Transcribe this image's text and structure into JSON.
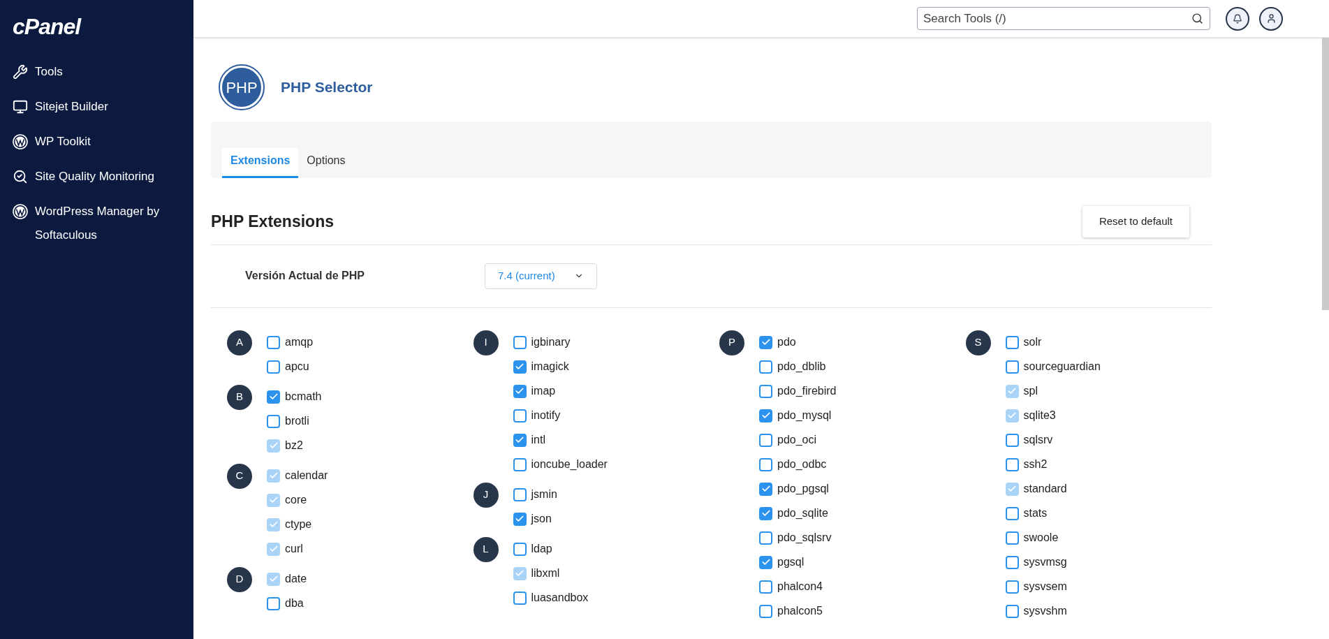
{
  "sidebar": {
    "logo": "cPanel",
    "items": [
      {
        "label": "Tools",
        "kind": "tools"
      },
      {
        "label": "Sitejet Builder",
        "kind": "builder"
      },
      {
        "label": "WP Toolkit",
        "kind": "wordpress"
      },
      {
        "label": "Site Quality Monitoring",
        "kind": "monitoring"
      },
      {
        "label": "WordPress Manager by Softaculous",
        "kind": "wordpress"
      }
    ]
  },
  "topbar": {
    "search": {
      "placeholder": "Search Tools (/)"
    }
  },
  "page": {
    "title": "PHP Selector",
    "icon_text": "PHP"
  },
  "tabs": [
    {
      "label": "Extensions",
      "selected": true
    },
    {
      "label": "Options",
      "selected": false
    }
  ],
  "section": {
    "title": "PHP Extensions",
    "reset_button": "Reset to default",
    "version_label": "Versión Actual de PHP",
    "version_value": "7.4 (current)"
  },
  "columns": [
    {
      "groups": [
        {
          "letter": "A",
          "items": [
            {
              "name": "amqp",
              "checked": false,
              "disabled": false
            },
            {
              "name": "apcu",
              "checked": false,
              "disabled": false
            }
          ]
        },
        {
          "letter": "B",
          "items": [
            {
              "name": "bcmath",
              "checked": true,
              "disabled": false
            },
            {
              "name": "brotli",
              "checked": false,
              "disabled": false
            },
            {
              "name": "bz2",
              "checked": true,
              "disabled": true
            }
          ]
        },
        {
          "letter": "C",
          "items": [
            {
              "name": "calendar",
              "checked": true,
              "disabled": true
            },
            {
              "name": "core",
              "checked": true,
              "disabled": true
            },
            {
              "name": "ctype",
              "checked": true,
              "disabled": true
            },
            {
              "name": "curl",
              "checked": true,
              "disabled": true
            }
          ]
        },
        {
          "letter": "D",
          "items": [
            {
              "name": "date",
              "checked": true,
              "disabled": true
            },
            {
              "name": "dba",
              "checked": false,
              "disabled": false
            }
          ]
        }
      ]
    },
    {
      "groups": [
        {
          "letter": "I",
          "items": [
            {
              "name": "igbinary",
              "checked": false,
              "disabled": false
            },
            {
              "name": "imagick",
              "checked": true,
              "disabled": false
            },
            {
              "name": "imap",
              "checked": true,
              "disabled": false
            },
            {
              "name": "inotify",
              "checked": false,
              "disabled": false
            },
            {
              "name": "intl",
              "checked": true,
              "disabled": false
            },
            {
              "name": "ioncube_loader",
              "checked": false,
              "disabled": false
            }
          ]
        },
        {
          "letter": "J",
          "items": [
            {
              "name": "jsmin",
              "checked": false,
              "disabled": false
            },
            {
              "name": "json",
              "checked": true,
              "disabled": false
            }
          ]
        },
        {
          "letter": "L",
          "items": [
            {
              "name": "ldap",
              "checked": false,
              "disabled": false
            },
            {
              "name": "libxml",
              "checked": true,
              "disabled": true
            },
            {
              "name": "luasandbox",
              "checked": false,
              "disabled": false
            }
          ]
        }
      ]
    },
    {
      "groups": [
        {
          "letter": "P",
          "items": [
            {
              "name": "pdo",
              "checked": true,
              "disabled": false
            },
            {
              "name": "pdo_dblib",
              "checked": false,
              "disabled": false
            },
            {
              "name": "pdo_firebird",
              "checked": false,
              "disabled": false
            },
            {
              "name": "pdo_mysql",
              "checked": true,
              "disabled": false
            },
            {
              "name": "pdo_oci",
              "checked": false,
              "disabled": false
            },
            {
              "name": "pdo_odbc",
              "checked": false,
              "disabled": false
            },
            {
              "name": "pdo_pgsql",
              "checked": true,
              "disabled": false
            },
            {
              "name": "pdo_sqlite",
              "checked": true,
              "disabled": false
            },
            {
              "name": "pdo_sqlsrv",
              "checked": false,
              "disabled": false
            },
            {
              "name": "pgsql",
              "checked": true,
              "disabled": false
            },
            {
              "name": "phalcon4",
              "checked": false,
              "disabled": false
            },
            {
              "name": "phalcon5",
              "checked": false,
              "disabled": false
            }
          ]
        }
      ]
    },
    {
      "groups": [
        {
          "letter": "S",
          "items": [
            {
              "name": "solr",
              "checked": false,
              "disabled": false
            },
            {
              "name": "sourceguardian",
              "checked": false,
              "disabled": false
            },
            {
              "name": "spl",
              "checked": true,
              "disabled": true
            },
            {
              "name": "sqlite3",
              "checked": true,
              "disabled": true
            },
            {
              "name": "sqlsrv",
              "checked": false,
              "disabled": false
            },
            {
              "name": "ssh2",
              "checked": false,
              "disabled": false
            },
            {
              "name": "standard",
              "checked": true,
              "disabled": true
            },
            {
              "name": "stats",
              "checked": false,
              "disabled": false
            },
            {
              "name": "swoole",
              "checked": false,
              "disabled": false
            },
            {
              "name": "sysvmsg",
              "checked": false,
              "disabled": false
            },
            {
              "name": "sysvsem",
              "checked": false,
              "disabled": false
            },
            {
              "name": "sysvshm",
              "checked": false,
              "disabled": false
            }
          ]
        }
      ]
    }
  ]
}
